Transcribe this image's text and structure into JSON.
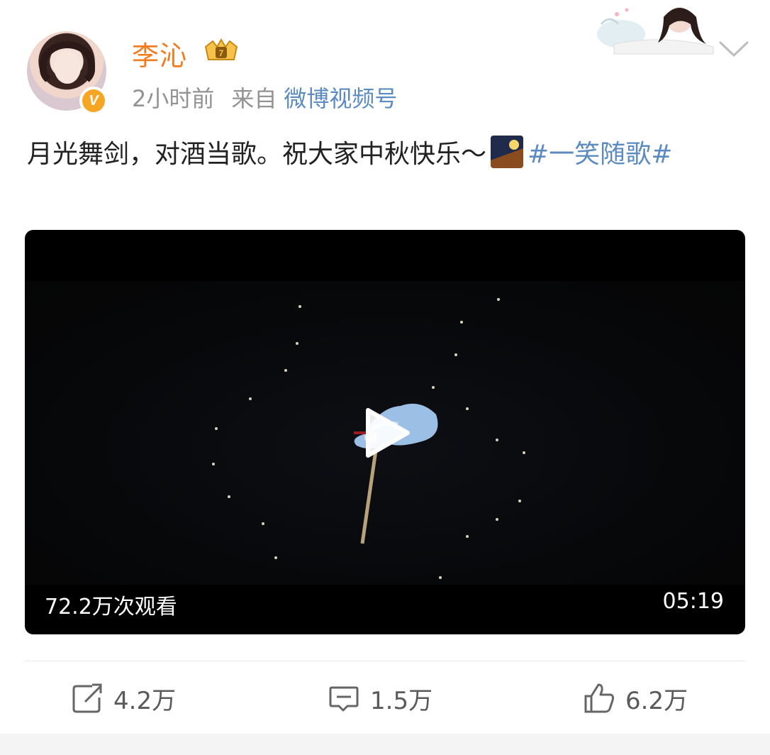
{
  "header": {
    "username": "李沁",
    "time": "2小时前",
    "from_label": "来自",
    "source": "微博视频号"
  },
  "post": {
    "text": "月光舞剑，对酒当歌。祝大家中秋快乐～",
    "hashtag_part1": "#一笑随",
    "hashtag_part2": "歌#"
  },
  "video": {
    "views": "72.2万次观看",
    "duration": "05:19"
  },
  "actions": {
    "repost": "4.2万",
    "comment": "1.5万",
    "like": "6.2万"
  },
  "colors": {
    "username": "#f37b1d",
    "link": "#5b8bc1",
    "verified": "#f6a623"
  },
  "icons": [
    "verified-icon",
    "crown-badge-icon",
    "chevron-down-icon",
    "play-icon",
    "repost-icon",
    "comment-icon",
    "like-icon"
  ]
}
